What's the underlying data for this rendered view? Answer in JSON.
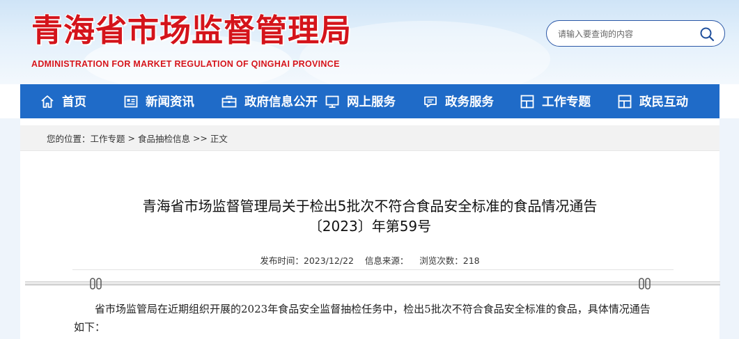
{
  "header": {
    "title": "青海省市场监督管理局",
    "subtitle": "ADMINISTRATION FOR MARKET REGULATION OF QINGHAI PROVINCE"
  },
  "search": {
    "placeholder": "请输入要查询的内容"
  },
  "nav": {
    "items": [
      {
        "label": "首页",
        "icon": "home-icon"
      },
      {
        "label": "新闻资讯",
        "icon": "news-icon"
      },
      {
        "label": "政府信息公开",
        "icon": "briefcase-icon"
      },
      {
        "label": "网上服务",
        "icon": "monitor-icon"
      },
      {
        "label": "政务服务",
        "icon": "chat-icon"
      },
      {
        "label": "工作专题",
        "icon": "layout-icon"
      },
      {
        "label": "政民互动",
        "icon": "layout-icon"
      }
    ],
    "color": "#1f6bc8"
  },
  "breadcrumb": {
    "prefix": "您的位置：",
    "items": [
      "工作专题",
      "食品抽检信息",
      "正文"
    ],
    "sep1": " > ",
    "sep2": " >> "
  },
  "article": {
    "title_line1": "青海省市场监督管理局关于检出5批次不符合食品安全标准的食品情况通告",
    "title_line2": "〔2023〕年第59号",
    "meta": {
      "publish_label": "发布时间：",
      "publish_date": "2023/12/22",
      "source_label": "信息来源：",
      "source_value": "",
      "views_label": "浏览次数：",
      "views_value": "218"
    },
    "body_p1": "省市场监管局在近期组织开展的2023年食品安全监督抽检任务中，检出5批次不符合食品安全标准的食品，具体情况通告如下："
  },
  "colors": {
    "brand_red": "#d4141b",
    "nav_blue": "#1f6bc8"
  }
}
